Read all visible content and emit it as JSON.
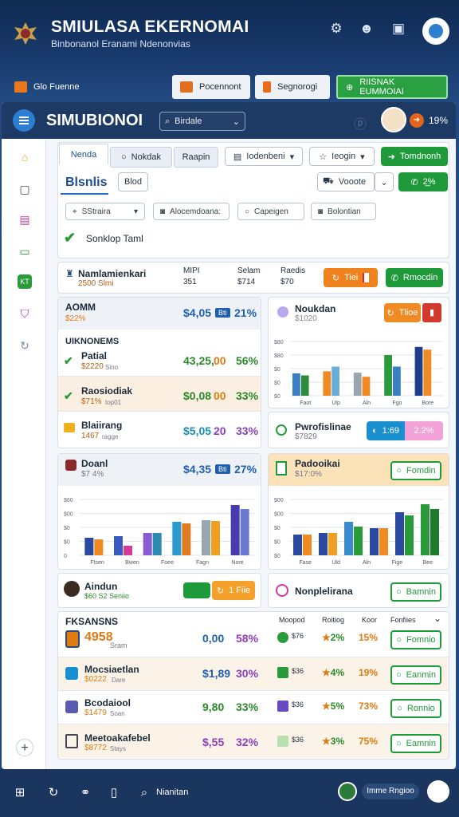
{
  "header": {
    "title": "SMIULASA EKERNOMAI",
    "subtitle": "Binbonanol Eranami Ndenonvias"
  },
  "nav": {
    "left_label": "Glo Fuenne",
    "mid1_label": "Pocennont",
    "mid2_label": "Segnorogi",
    "right_label": "RIISNAK EUMMOIAI"
  },
  "app": {
    "title": "SIMUBIONOI",
    "search_value": "Birdale",
    "percent": "19%"
  },
  "toolbar": {
    "tab_active": "Nenda",
    "tab2": "Nokdak",
    "tab3": "Raapin",
    "dropdown1": "Iodenbeni",
    "dropdown2": "Ieogin",
    "green_btn": "Tomdnonh",
    "section_title": "Blsnlis",
    "bold_btn": "Blod",
    "voode_btn": "Vooote",
    "pct_btn": "2̲%",
    "filters": [
      "SStraira",
      "Alocemdoana:",
      "Capeigen",
      "Bolontian"
    ],
    "check_label": "Sonklop Taml"
  },
  "summary": {
    "name": "Namlamienkari",
    "sub": "2500 Slmi",
    "c1_label": "MIPI",
    "c1_val": "351",
    "c2_label": "Selam",
    "c2_val": "$714",
    "c3_label": "Raedis",
    "c3_val": "$70",
    "btn_orange": "Tiei",
    "btn_green": "Rmocdin"
  },
  "left_top": {
    "name": "AOMM",
    "sub": "$22%",
    "val": "$4,05",
    "badge": "Bti",
    "pct": "21%",
    "section": "UIKNONEMS",
    "rows": [
      {
        "name": "Patial",
        "sub": "$2220",
        "tag": "Sino",
        "val": "43,25,",
        "mid": "00",
        "pct": "56%",
        "val_color": "green"
      },
      {
        "name": "Raosiodiak",
        "sub": "$71%",
        "tag": "top01",
        "val": "$0,08",
        "mid": "00",
        "pct": "33%",
        "val_color": "green"
      },
      {
        "name": "Blaiirang",
        "sub": "1467",
        "tag": "ragge",
        "val": "$5,05",
        "mid": "20",
        "pct": "33%",
        "val_color": "teal"
      }
    ]
  },
  "right_top": {
    "name": "Noukdan",
    "sub": "$1020",
    "btn": "Tlioe",
    "chart_y": [
      "$80",
      "$80",
      "$0",
      "$0",
      "$0"
    ],
    "chart_x": [
      "Faot",
      "Ulp",
      "Aln",
      "Fgo",
      "Bore"
    ]
  },
  "right_mid": {
    "name": "Pwrofislinae",
    "sub": "$7829",
    "toggle1": "1:69",
    "toggle2": "2.2%"
  },
  "left_chart_card": {
    "name": "Doanl",
    "sub": "$7 4%",
    "val": "$4,35",
    "badge": "Bti",
    "pct": "27%",
    "chart_y": [
      "$60",
      "$00",
      "$0",
      "$0",
      "0"
    ],
    "chart_x": [
      "Ftsen",
      "Bwen",
      "Foee",
      "Fagn",
      "Nore"
    ]
  },
  "right_chart_card": {
    "name": "Padooikai",
    "sub": "$17:0%",
    "btn": "Fomdin",
    "chart_y": [
      "$00",
      "$00",
      "$0",
      "$0",
      "$0"
    ],
    "chart_x": [
      "Fase",
      "Uld",
      "Aln",
      "Fige",
      "Bee"
    ]
  },
  "person_row": {
    "name": "Aindun",
    "sub": "$60 S2 Seniio",
    "btn": "1 Fiie"
  },
  "person_row2": {
    "name": "Nonplelirana",
    "btn": "Bamnin"
  },
  "table": {
    "title": "FKSANSNS",
    "cols": [
      "Moopod",
      "Roitiog",
      "Koor",
      "Fonfiies"
    ],
    "rows": [
      {
        "name": "4958",
        "sub": "Sram",
        "val": "0,00",
        "pct": "58%",
        "m1": "$76",
        "m2": "2%",
        "m3": "15%",
        "btn": "Fomnio",
        "color": "blue"
      },
      {
        "name": "Mocsiaetlan",
        "sub": "$0222",
        "tag": "Dare",
        "val": "$1,89",
        "pct": "30%",
        "m1": "$36",
        "m2": "4%",
        "m3": "19%",
        "btn": "Eanmin",
        "color": "blue"
      },
      {
        "name": "Bcodaiool",
        "sub": "$1479",
        "tag": "Soan",
        "val": "9,80",
        "pct": "33%",
        "m1": "$36",
        "m2": "5%",
        "m3": "73%",
        "btn": "Ronnio",
        "color": "green"
      },
      {
        "name": "Meetoakafebel",
        "sub": "$8772",
        "tag": "Stays",
        "val": "$,55",
        "pct": "32%",
        "m1": "$36",
        "m2": "3%",
        "m3": "75%",
        "btn": "Eamnin",
        "color": "purple"
      }
    ]
  },
  "taskbar": {
    "label": "Nianitan",
    "pill": "Imme Rngioo"
  },
  "chart_data": [
    {
      "type": "bar",
      "categories": [
        "Faot",
        "Ulp",
        "Aln",
        "Fgo",
        "Bore"
      ],
      "series": [
        {
          "values": [
            33,
            36,
            34,
            60,
            72
          ]
        },
        {
          "values": [
            30,
            43,
            28,
            43,
            68
          ]
        },
        {
          "values": [
            0,
            0,
            0,
            0,
            0
          ]
        }
      ],
      "ylim": [
        0,
        80
      ]
    },
    {
      "type": "bar",
      "categories": [
        "Ftsen",
        "Bwen",
        "Foee",
        "Fagn",
        "Nore"
      ],
      "series": [
        {
          "values": [
            22,
            24,
            28,
            42,
            44,
            63
          ]
        },
        {
          "values": [
            20,
            12,
            28,
            40,
            43,
            58
          ]
        }
      ],
      "ylim": [
        0,
        70
      ]
    },
    {
      "type": "bar",
      "categories": [
        "Fase",
        "Uld",
        "Aln",
        "Fige",
        "Bee"
      ],
      "series": [
        {
          "values": [
            26,
            28,
            42,
            34,
            54,
            64
          ]
        },
        {
          "values": [
            26,
            28,
            36,
            34,
            50,
            58
          ]
        }
      ],
      "ylim": [
        0,
        70
      ]
    }
  ]
}
